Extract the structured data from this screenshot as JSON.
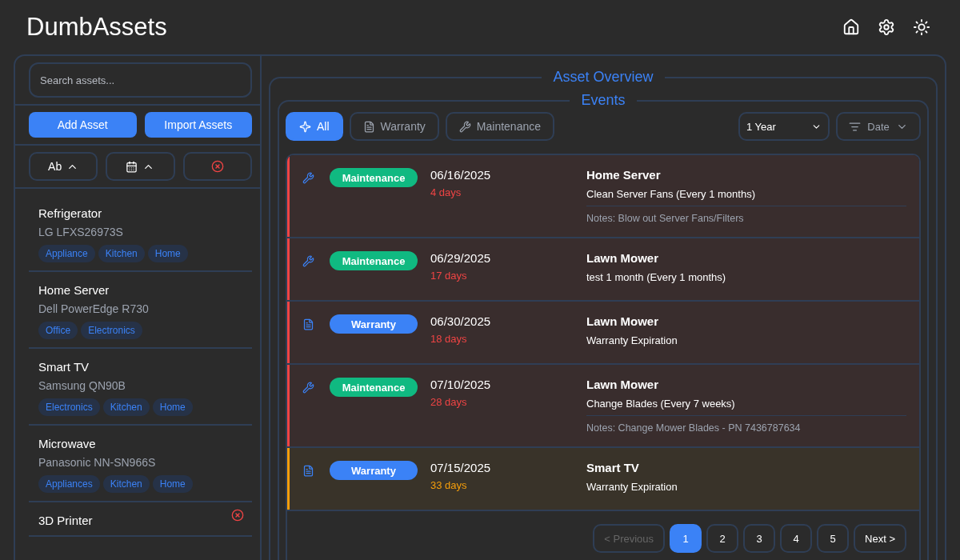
{
  "header": {
    "title": "DumbAssets"
  },
  "sidebar": {
    "search": {
      "placeholder": "Search assets..."
    },
    "buttons": [
      "Add Asset",
      "Import Assets"
    ],
    "sort": [
      {
        "kind": "name",
        "label": "Ab"
      },
      {
        "kind": "date"
      },
      {
        "kind": "clear"
      }
    ],
    "assets": [
      {
        "name": "Refrigerator",
        "model": "LG LFXS26973S",
        "tags": [
          "Appliance",
          "Kitchen",
          "Home"
        ],
        "hovered": false
      },
      {
        "name": "Home Server",
        "model": "Dell PowerEdge R730",
        "tags": [
          "Office",
          "Electronics"
        ],
        "hovered": false
      },
      {
        "name": "Smart TV",
        "model": "Samsung QN90B",
        "tags": [
          "Electronics",
          "Kitchen",
          "Home"
        ],
        "hovered": false
      },
      {
        "name": "Microwave",
        "model": "Panasonic NN-SN966S",
        "tags": [
          "Appliances",
          "Kitchen",
          "Home"
        ],
        "hovered": false
      },
      {
        "name": "3D Printer",
        "hovered": true
      }
    ]
  },
  "overview": {
    "title": "Asset Overview",
    "events": {
      "title": "Events",
      "filters": [
        {
          "kind": "all",
          "label": "All",
          "selected": true
        },
        {
          "kind": "warranty",
          "label": "Warranty",
          "selected": false
        },
        {
          "kind": "maintenance",
          "label": "Maintenance",
          "selected": false
        }
      ],
      "range": "1 Year",
      "sort": "Date",
      "items": [
        {
          "kind": "maintenance",
          "badge": "Maintenance",
          "date": "06/16/2025",
          "due": "4 days",
          "color": "#ef4444",
          "asset": "Home Server",
          "task": "Clean Server Fans (Every 1 months)",
          "notes": "Notes: Blow out Server Fans/Filters"
        },
        {
          "kind": "maintenance",
          "badge": "Maintenance",
          "date": "06/29/2025",
          "due": "17 days",
          "color": "#ef4444",
          "asset": "Lawn Mower",
          "task": "test 1 month (Every 1 months)"
        },
        {
          "kind": "warranty",
          "badge": "Warranty",
          "date": "06/30/2025",
          "due": "18 days",
          "color": "#ef4444",
          "asset": "Lawn Mower",
          "task": "Warranty Expiration"
        },
        {
          "kind": "maintenance",
          "badge": "Maintenance",
          "date": "07/10/2025",
          "due": "28 days",
          "color": "#ef4444",
          "asset": "Lawn Mower",
          "task": "Change Blades (Every 7 weeks)",
          "notes": "Notes: Change Mower Blades - PN 7436787634"
        },
        {
          "kind": "warranty",
          "badge": "Warranty",
          "date": "07/15/2025",
          "due": "33 days",
          "color": "#f59e0b",
          "asset": "Smart TV",
          "task": "Warranty Expiration"
        }
      ],
      "pagination": [
        {
          "kind": "prev",
          "label": "< Previous",
          "selected": false
        },
        {
          "kind": "page",
          "label": "1",
          "selected": true
        },
        {
          "kind": "page",
          "label": "2",
          "selected": false
        },
        {
          "kind": "page",
          "label": "3",
          "selected": false
        },
        {
          "kind": "page",
          "label": "4",
          "selected": false
        },
        {
          "kind": "page",
          "label": "5",
          "selected": false
        },
        {
          "kind": "next",
          "label": "Next >",
          "selected": false
        }
      ]
    }
  }
}
